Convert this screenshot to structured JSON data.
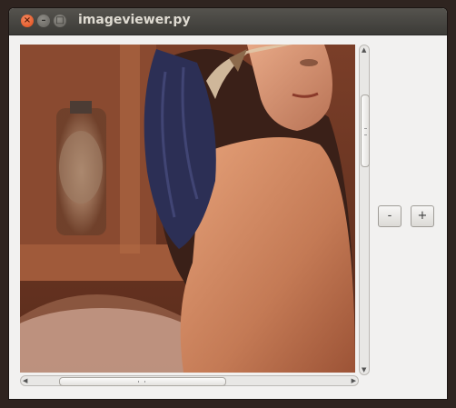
{
  "window": {
    "title": "imageviewer.py",
    "controls": {
      "close_glyph": "×",
      "minimize_glyph": "–",
      "maximize_glyph": "□"
    }
  },
  "toolbar": {
    "zoom_out_label": "-",
    "zoom_in_label": "+"
  },
  "scrollbars": {
    "vertical_position": 0.15,
    "horizontal_position": 0.12,
    "up_arrow": "▲",
    "down_arrow": "▼",
    "left_arrow": "◀",
    "right_arrow": "▶"
  },
  "colors": {
    "titlebar": "#3c3b37",
    "window_bg": "#f2f1f0",
    "close_button": "#df4a16"
  }
}
